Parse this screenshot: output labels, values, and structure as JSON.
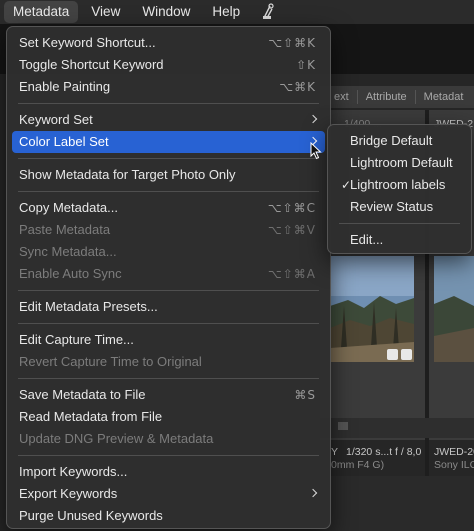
{
  "menubar": {
    "items": [
      "Metadata",
      "View",
      "Window",
      "Help"
    ],
    "icon": "script-icon"
  },
  "main_menu": {
    "items": [
      {
        "label": "Set Keyword Shortcut...",
        "shortcut": "⌥⇧⌘K",
        "disabled": false
      },
      {
        "label": "Toggle Shortcut Keyword",
        "shortcut": "⇧K",
        "disabled": false
      },
      {
        "label": "Enable Painting",
        "shortcut": "⌥⌘K",
        "disabled": false
      },
      {
        "label": "Keyword Set",
        "submenu": true
      },
      {
        "label": "Color Label Set",
        "submenu": true,
        "highlighted": true
      },
      {
        "label": "Show Metadata for Target Photo Only"
      },
      {
        "label": "Copy Metadata...",
        "shortcut": "⌥⇧⌘C"
      },
      {
        "label": "Paste Metadata",
        "shortcut": "⌥⇧⌘V",
        "disabled": true
      },
      {
        "label": "Sync Metadata...",
        "disabled": true
      },
      {
        "label": "Enable Auto Sync",
        "shortcut": "⌥⇧⌘A",
        "disabled": true
      },
      {
        "label": "Edit Metadata Presets..."
      },
      {
        "label": "Edit Capture Time..."
      },
      {
        "label": "Revert Capture Time to Original",
        "disabled": true
      },
      {
        "label": "Save Metadata to File",
        "shortcut": "⌘S"
      },
      {
        "label": "Read Metadata from File"
      },
      {
        "label": "Update DNG Preview & Metadata",
        "disabled": true
      },
      {
        "label": "Import Keywords..."
      },
      {
        "label": "Export Keywords",
        "submenu": true
      },
      {
        "label": "Purge Unused Keywords"
      }
    ]
  },
  "sub_menu": {
    "items": [
      {
        "label": "Bridge Default"
      },
      {
        "label": "Lightroom Default"
      },
      {
        "label": "Lightroom labels",
        "checked": true
      },
      {
        "label": "Review Status"
      },
      {
        "label": "Edit..."
      }
    ]
  },
  "background": {
    "filter_tabs": [
      "ext",
      "Attribute",
      "Metadat"
    ],
    "caption_top_left": "1/400 ...",
    "caption_top_right": "JWED-2",
    "caption_bottom_left": "1/320 s...t f / 8,0",
    "caption_bottom_sub": "0mm F4 G)",
    "caption_bottom_right": "JWED-20",
    "caption_bottom_right_sub": "Sony ILC",
    "marker": "Y"
  },
  "colors": {
    "highlight": "#2862d3",
    "menu_bg": "#2e2e2e",
    "disabled_text": "#7c7c7c"
  }
}
